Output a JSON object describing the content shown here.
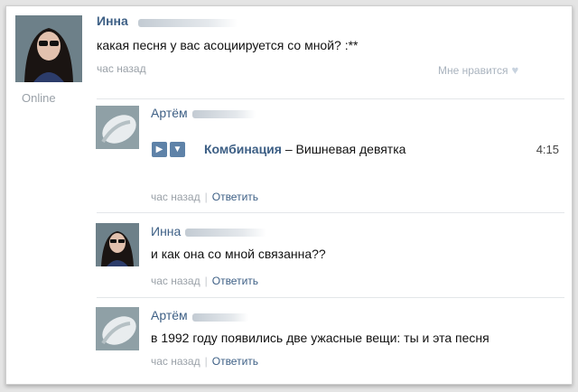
{
  "colors": {
    "link": "#3d5f85",
    "muted": "#9aa1a8",
    "audio_button": "#5e82a8"
  },
  "post": {
    "author": "Инна",
    "text": "какая песня у вас асоциируется со мной? :**",
    "time": "час назад",
    "like_label": "Мне нравится",
    "online": "Online"
  },
  "comments": [
    {
      "author": "Артём",
      "audio": {
        "artist": "Комбинация",
        "dash": "–",
        "title": "Вишневая девятка",
        "duration": "4:15"
      },
      "time": "час назад",
      "reply": "Ответить"
    },
    {
      "author": "Инна",
      "text": "и как она со мной связанна??",
      "time": "час назад",
      "reply": "Ответить"
    },
    {
      "author": "Артём",
      "text": "в 1992 году появились две ужасные вещи: ты и эта песня",
      "time": "час назад",
      "reply": "Ответить"
    }
  ],
  "separator": "|"
}
